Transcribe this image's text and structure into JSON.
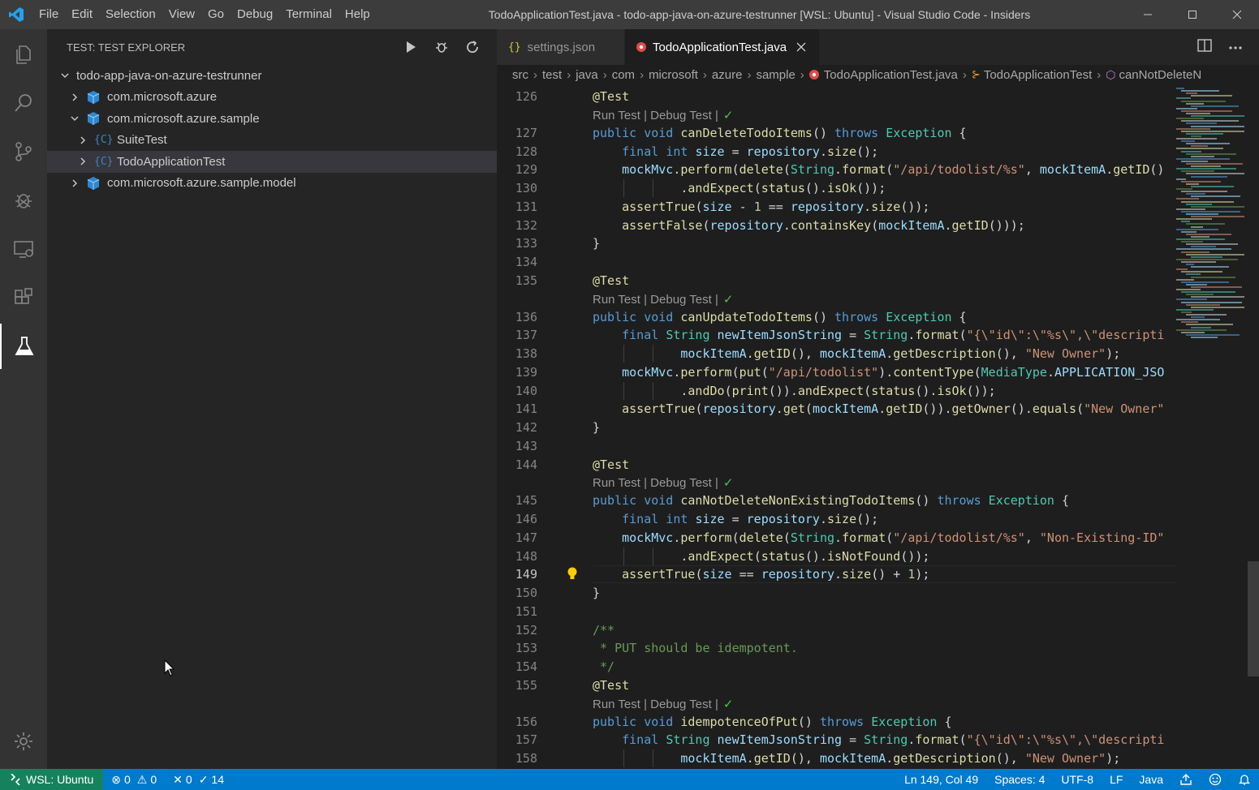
{
  "window": {
    "title": "TodoApplicationTest.java - todo-app-java-on-azure-testrunner [WSL: Ubuntu] - Visual Studio Code - Insiders",
    "menu": [
      "File",
      "Edit",
      "Selection",
      "View",
      "Go",
      "Debug",
      "Terminal",
      "Help"
    ]
  },
  "sidebar": {
    "header": "TEST: TEST EXPLORER",
    "root": "todo-app-java-on-azure-testrunner",
    "items": [
      {
        "label": "com.microsoft.azure",
        "kind": "package",
        "expanded": false
      },
      {
        "label": "com.microsoft.azure.sample",
        "kind": "package",
        "expanded": true
      },
      {
        "label": "SuiteTest",
        "kind": "class",
        "expanded": false
      },
      {
        "label": "TodoApplicationTest",
        "kind": "class",
        "expanded": false,
        "selected": true
      },
      {
        "label": "com.microsoft.azure.sample.model",
        "kind": "package",
        "expanded": false
      }
    ]
  },
  "tabs": [
    {
      "label": "settings.json",
      "icon": "{}",
      "active": false
    },
    {
      "label": "TodoApplicationTest.java",
      "active": true
    }
  ],
  "breadcrumb": [
    "src",
    "test",
    "java",
    "com",
    "microsoft",
    "azure",
    "sample",
    "TodoApplicationTest.java",
    "TodoApplicationTest",
    "canNotDeleteN"
  ],
  "codelens": {
    "run": "Run Test",
    "sep": "|",
    "debug": "Debug Test",
    "check": "✓"
  },
  "code": [
    {
      "n": "126",
      "t": "@Test"
    },
    {
      "lens": true
    },
    {
      "n": "127",
      "t": "public void canDeleteTodoItems() throws Exception {"
    },
    {
      "n": "128",
      "t": "    final int size = repository.size();"
    },
    {
      "n": "129",
      "t": "    mockMvc.perform(delete(String.format(\"/api/todolist/%s\", mockItemA.getID()"
    },
    {
      "n": "130",
      "t": "            .andExpect(status().isOk());"
    },
    {
      "n": "131",
      "t": "    assertTrue(size - 1 == repository.size());"
    },
    {
      "n": "132",
      "t": "    assertFalse(repository.containsKey(mockItemA.getID()));"
    },
    {
      "n": "133",
      "t": "}"
    },
    {
      "n": "134",
      "t": ""
    },
    {
      "n": "135",
      "t": "@Test"
    },
    {
      "lens": true
    },
    {
      "n": "136",
      "t": "public void canUpdateTodoItems() throws Exception {"
    },
    {
      "n": "137",
      "t": "    final String newItemJsonString = String.format(\"{\\\"id\\\":\\\"%s\\\",\\\"descripti"
    },
    {
      "n": "138",
      "t": "            mockItemA.getID(), mockItemA.getDescription(), \"New Owner\");"
    },
    {
      "n": "139",
      "t": "    mockMvc.perform(put(\"/api/todolist\").contentType(MediaType.APPLICATION_JSO"
    },
    {
      "n": "140",
      "t": "            .andDo(print()).andExpect(status().isOk());"
    },
    {
      "n": "141",
      "t": "    assertTrue(repository.get(mockItemA.getID()).getOwner().equals(\"New Owner\""
    },
    {
      "n": "142",
      "t": "}"
    },
    {
      "n": "143",
      "t": ""
    },
    {
      "n": "144",
      "t": "@Test"
    },
    {
      "lens": true
    },
    {
      "n": "145",
      "t": "public void canNotDeleteNonExistingTodoItems() throws Exception {"
    },
    {
      "n": "146",
      "t": "    final int size = repository.size();"
    },
    {
      "n": "147",
      "t": "    mockMvc.perform(delete(String.format(\"/api/todolist/%s\", \"Non-Existing-ID\""
    },
    {
      "n": "148",
      "t": "            .andExpect(status().isNotFound());"
    },
    {
      "n": "149",
      "t": "    assertTrue(size == repository.size() + 1);",
      "current": true
    },
    {
      "n": "150",
      "t": "}"
    },
    {
      "n": "151",
      "t": ""
    },
    {
      "n": "152",
      "t": "/**"
    },
    {
      "n": "153",
      "t": " * PUT should be idempotent."
    },
    {
      "n": "154",
      "t": " */"
    },
    {
      "n": "155",
      "t": "@Test"
    },
    {
      "lens": true
    },
    {
      "n": "156",
      "t": "public void idempotenceOfPut() throws Exception {"
    },
    {
      "n": "157",
      "t": "    final String newItemJsonString = String.format(\"{\\\"id\\\":\\\"%s\\\",\\\"descripti"
    },
    {
      "n": "158",
      "t": "            mockItemA.getID(), mockItemA.getDescription(), \"New Owner\");"
    }
  ],
  "status": {
    "remote": "WSL: Ubuntu",
    "errors": "0",
    "warnings": "0",
    "tests_failed": "0",
    "tests_passed": "14",
    "position": "Ln 149, Col 49",
    "spaces": "Spaces: 4",
    "encoding": "UTF-8",
    "eol": "LF",
    "language": "Java"
  },
  "colors": {
    "statusbar": "#007acc",
    "remote": "#16825d",
    "keyword": "#569cd6",
    "type": "#4ec9b0",
    "string": "#ce9178",
    "function": "#dcdcaa"
  }
}
